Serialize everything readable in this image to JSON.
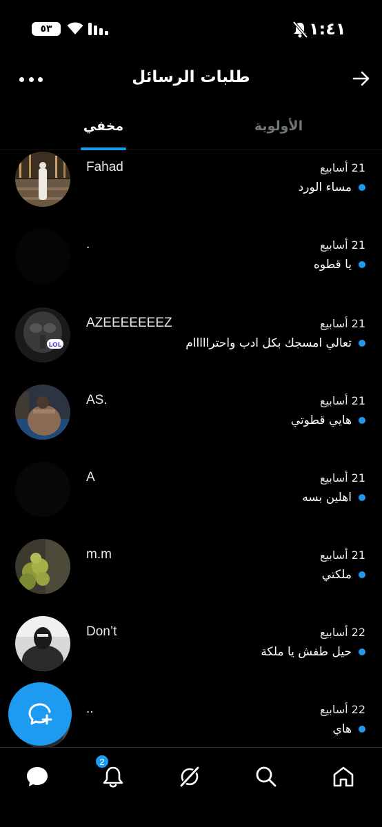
{
  "status_bar": {
    "time": "١:٤١",
    "battery": "٥٣"
  },
  "header": {
    "title": "طلبات الرسائل"
  },
  "tabs": [
    {
      "label": "مخفي",
      "active": true
    },
    {
      "label": "الأولوية",
      "active": false
    }
  ],
  "conversations": [
    {
      "name": "Fahad",
      "time": "21 أسابيع",
      "message": "مساء الورد"
    },
    {
      "name": ".",
      "time": "21 أسابيع",
      "message": "يا قطوه"
    },
    {
      "name": "AZEEEEEEEZ",
      "time": "21 أسابيع",
      "message": "تعالي امسجك بكل ادب واحترااااام"
    },
    {
      "name": "AS.",
      "time": "21 أسابيع",
      "message": "هايي قطوتي"
    },
    {
      "name": "A",
      "time": "21 أسابيع",
      "message": "اهلين بسه"
    },
    {
      "name": "m.m",
      "time": "21 أسابيع",
      "message": "ملكتي"
    },
    {
      "name": "Don’t",
      "time": "22 أسابيع",
      "message": "حيل طفش يا ملكة"
    },
    {
      "name": "..",
      "time": "22 أسابيع",
      "message": "هاي"
    }
  ],
  "bottom_nav": {
    "notifications_badge": "2",
    "items": [
      "messages-icon",
      "notifications-icon",
      "grok-icon",
      "search-icon",
      "home-icon"
    ]
  },
  "colors": {
    "accent": "#1d9bf0",
    "background": "#000000",
    "text": "#e7e9ea",
    "muted": "#71767b"
  }
}
